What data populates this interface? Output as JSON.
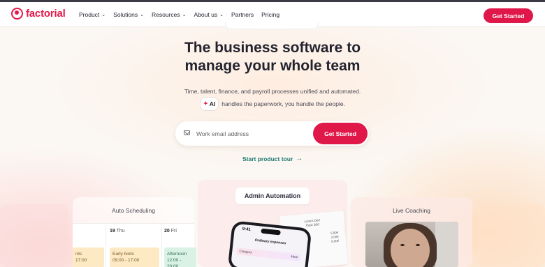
{
  "nav": {
    "logo": "factorial",
    "menu": [
      {
        "label": "Product",
        "dropdown": true
      },
      {
        "label": "Solutions",
        "dropdown": true
      },
      {
        "label": "Resources",
        "dropdown": true
      },
      {
        "label": "About us",
        "dropdown": true
      },
      {
        "label": "Partners",
        "dropdown": false
      },
      {
        "label": "Pricing",
        "dropdown": false
      }
    ],
    "cta": "Get Started"
  },
  "hero": {
    "title_line1": "The business software to",
    "title_line2": "manage your whole team",
    "subtitle_line1": "Time, talent, finance, and payroll processes unified and automated.",
    "ai_badge": "AI",
    "subtitle_line2": "handles the paperwork, you handle the people.",
    "email_placeholder": "Work email address",
    "email_cta": "Get Started",
    "tour_link": "Start product tour"
  },
  "cards": {
    "scheduling": {
      "title": "Auto Scheduling",
      "days": [
        {
          "num": "19",
          "name": "Thu"
        },
        {
          "num": "20",
          "name": "Fri"
        }
      ],
      "slots": [
        {
          "label": "rds",
          "time": "17:00"
        },
        {
          "label": "Early birds",
          "time": "09:00 - 17:00"
        },
        {
          "label": "Afternoon",
          "time": "12:00 - 20:00"
        }
      ]
    },
    "admin": {
      "title": "Admin Automation",
      "phone_time": "9:41",
      "phone_heading": "Ordinary expenses",
      "phone_field": "Category",
      "phone_field_value": "Meal",
      "receipt_lines": [
        "Luna's Deli",
        "Total: $00",
        "5.90€",
        "3.00€",
        "9.00€"
      ]
    },
    "coaching": {
      "title": "Live Coaching"
    }
  },
  "colors": {
    "brand": "#e0184a",
    "link": "#1d7a74"
  }
}
